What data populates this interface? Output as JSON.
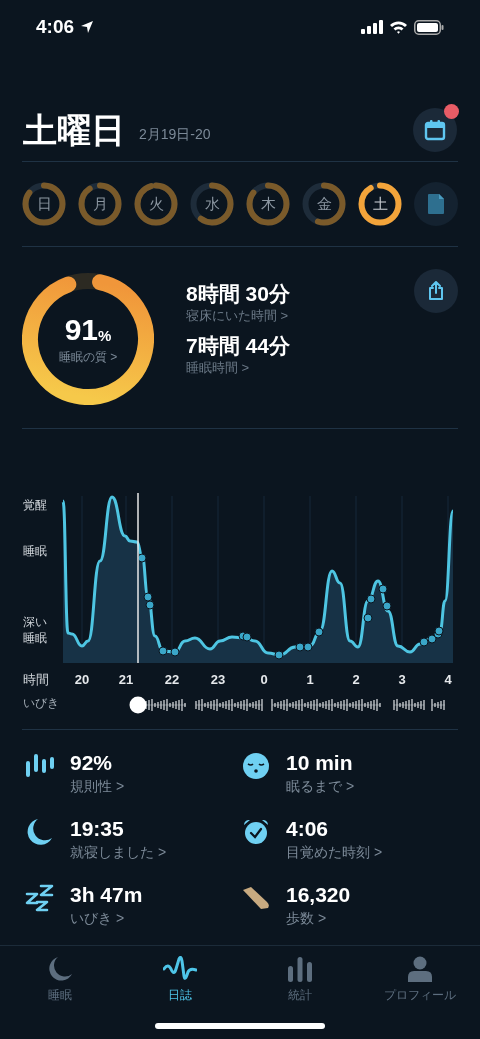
{
  "status_bar": {
    "time": "4:06"
  },
  "header": {
    "title": "土曜日",
    "date_range": "2月19日-20",
    "calendar_badge": true
  },
  "days": [
    {
      "label": "日",
      "selected": false
    },
    {
      "label": "月",
      "selected": false
    },
    {
      "label": "火",
      "selected": false
    },
    {
      "label": "水",
      "selected": false
    },
    {
      "label": "木",
      "selected": false
    },
    {
      "label": "金",
      "selected": false
    },
    {
      "label": "土",
      "selected": true
    }
  ],
  "summary": {
    "quality": {
      "value": "91",
      "unit": "%",
      "label": "睡眠の質 >"
    },
    "metrics": [
      {
        "value": "8時間 30分",
        "label": "寝床にいた時間 >"
      },
      {
        "value": "7時間 44分",
        "label": "睡眠時間 >"
      }
    ]
  },
  "graph": {
    "y_labels": [
      "覚醒",
      "睡眠",
      "深い睡眠"
    ],
    "x_axis_title": "時間",
    "x_labels": [
      "20",
      "21",
      "22",
      "23",
      "0",
      "1",
      "2",
      "3",
      "4"
    ],
    "snore_label": "いびき"
  },
  "stats": [
    {
      "value": "92%",
      "label": "規則性 >"
    },
    {
      "value": "10 min",
      "label": "眠るまで >"
    },
    {
      "value": "19:35",
      "label": "就寝しました >"
    },
    {
      "value": "4:06",
      "label": "目覚めた時刻 >"
    },
    {
      "value": "3h 47m",
      "label": "いびき >"
    },
    {
      "value": "16,320",
      "label": "歩数 >"
    }
  ],
  "tab_bar": [
    {
      "label": "睡眠",
      "selected": false
    },
    {
      "label": "日誌",
      "selected": true
    },
    {
      "label": "統計",
      "selected": false
    },
    {
      "label": "プロフィール",
      "selected": false
    }
  ]
}
